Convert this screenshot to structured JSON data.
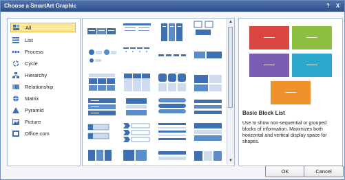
{
  "window": {
    "title": "Choose a SmartArt Graphic",
    "help": "?",
    "close": "X"
  },
  "categories": [
    {
      "label": "All",
      "icon": "all-icon",
      "selected": true
    },
    {
      "label": "List",
      "icon": "list-icon"
    },
    {
      "label": "Process",
      "icon": "process-icon"
    },
    {
      "label": "Cycle",
      "icon": "cycle-icon"
    },
    {
      "label": "Hierarchy",
      "icon": "hierarchy-icon"
    },
    {
      "label": "Relationship",
      "icon": "relationship-icon"
    },
    {
      "label": "Matrix",
      "icon": "matrix-icon"
    },
    {
      "label": "Pyramid",
      "icon": "pyramid-icon"
    },
    {
      "label": "Picture",
      "icon": "picture-icon"
    },
    {
      "label": "Office.com",
      "icon": "office-icon"
    }
  ],
  "preview": {
    "title": "Basic Block List",
    "description": "Use to show non-sequential or grouped blocks of information. Maximizes both horizontal and vertical display space for shapes.",
    "block_colors": [
      "#d9463f",
      "#8dbf43",
      "#7a5db0",
      "#2aa7cb",
      "#f0922b"
    ]
  },
  "buttons": {
    "ok": "OK",
    "cancel": "Cancel"
  },
  "colors": {
    "accent": "#3d6fb3",
    "selection": "#fde79a"
  }
}
